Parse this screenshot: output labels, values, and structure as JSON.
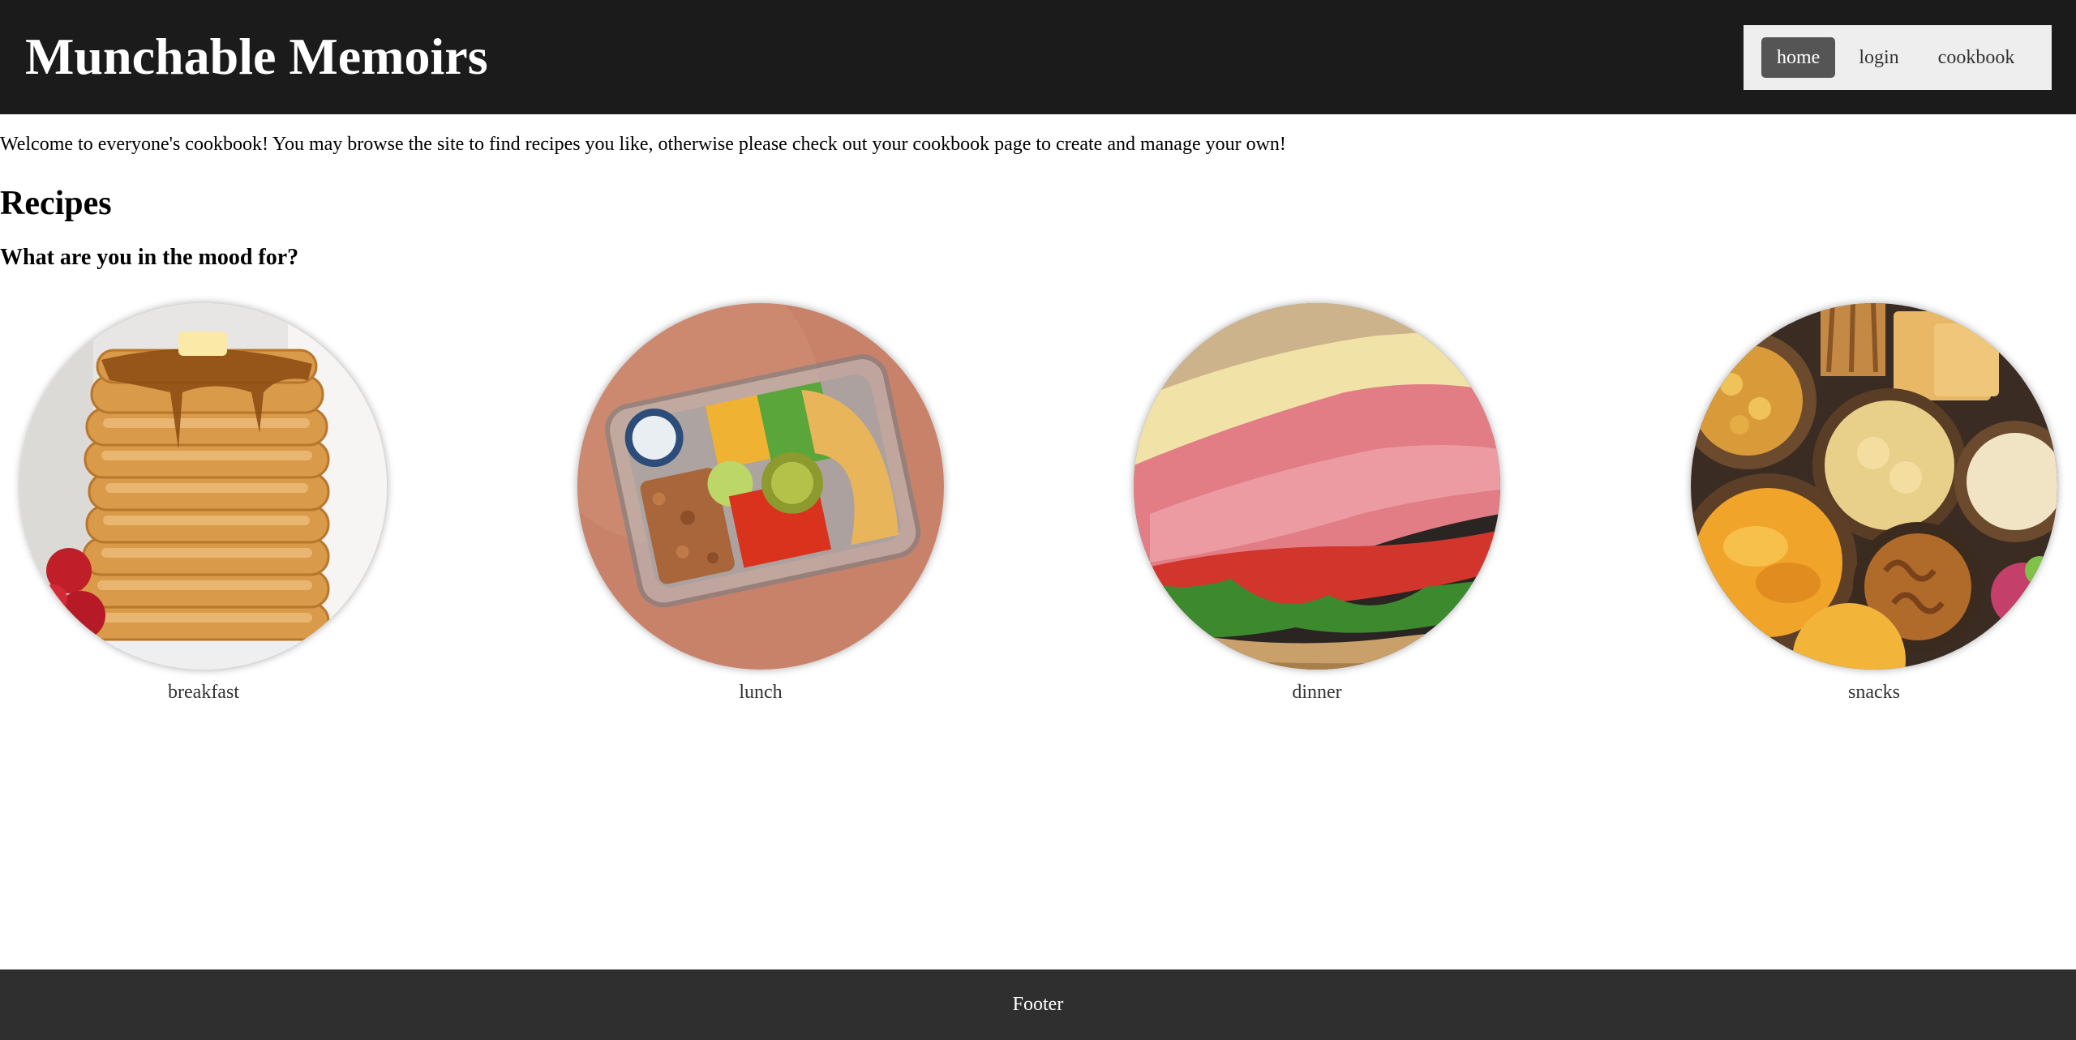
{
  "header": {
    "title": "Munchable Memoirs",
    "nav": [
      {
        "label": "home",
        "active": true
      },
      {
        "label": "login",
        "active": false
      },
      {
        "label": "cookbook",
        "active": false
      }
    ]
  },
  "main": {
    "welcome_text": "Welcome to everyone's cookbook! You may browse the site to find recipes you like, otherwise please check out your cookbook page to create and manage your own!",
    "recipes_heading": "Recipes",
    "mood_heading": "What are you in the mood for?",
    "categories": [
      {
        "label": "breakfast",
        "image": "pancake-stack"
      },
      {
        "label": "lunch",
        "image": "meal-prep-container"
      },
      {
        "label": "dinner",
        "image": "deli-sandwich"
      },
      {
        "label": "snacks",
        "image": "snack-bowls"
      }
    ]
  },
  "footer": {
    "text": "Footer"
  },
  "colors": {
    "header_bg": "#1b1b1b",
    "nav_bg": "#eeeeee",
    "nav_active_bg": "#555555",
    "footer_bg": "#2f2f2f"
  }
}
